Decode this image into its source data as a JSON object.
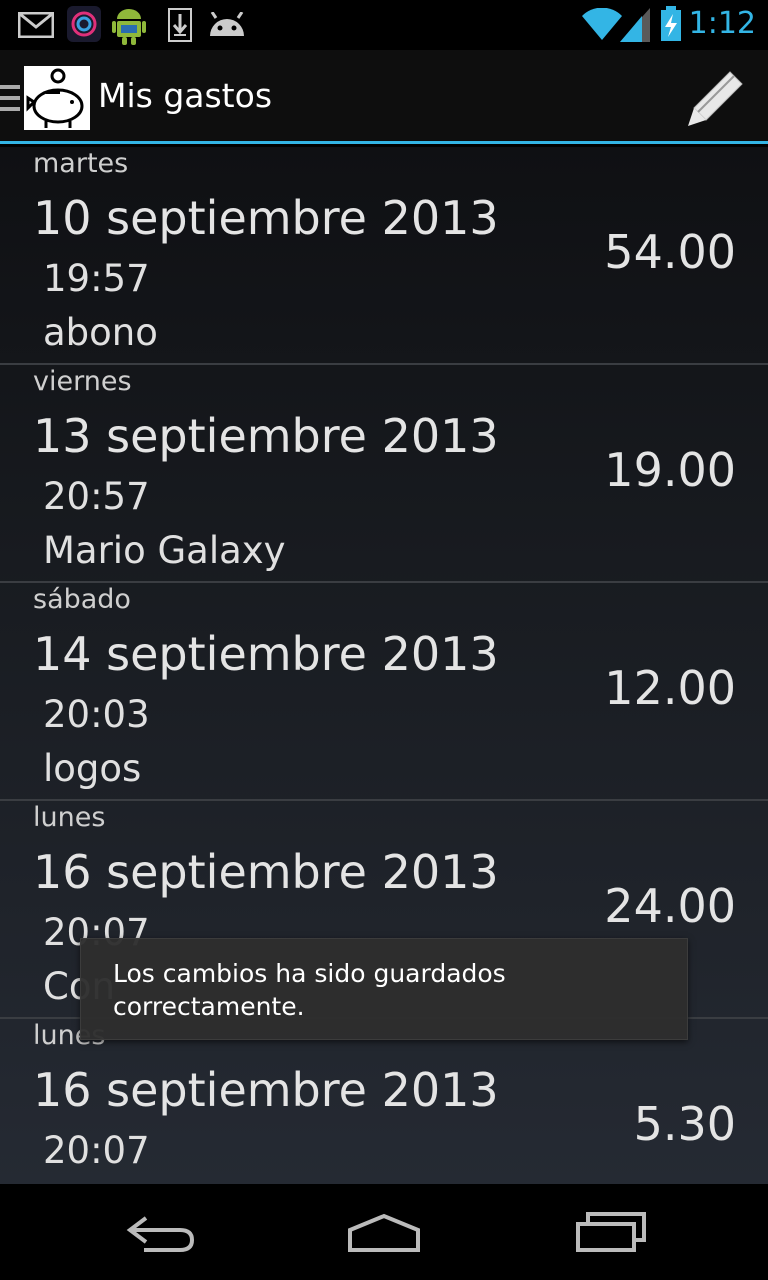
{
  "status_bar": {
    "time": "1:12",
    "icons": [
      "gmail-icon",
      "app-icon",
      "android-icon",
      "download-icon",
      "android-face-icon",
      "wifi-icon",
      "signal-icon",
      "battery-charging-icon"
    ]
  },
  "action_bar": {
    "title": "Mis gastos",
    "icons": [
      "up-icon",
      "piggy-bank-app-icon",
      "pencil-edit-icon"
    ]
  },
  "expenses": [
    {
      "day": "martes",
      "date": "10 septiembre 2013",
      "time": "19:57",
      "description": "abono",
      "amount": "54.00"
    },
    {
      "day": "viernes",
      "date": "13 septiembre 2013",
      "time": "20:57",
      "description": "Mario Galaxy",
      "amount": "19.00"
    },
    {
      "day": "sábado",
      "date": "14 septiembre 2013",
      "time": "20:03",
      "description": "logos",
      "amount": "12.00"
    },
    {
      "day": "lunes",
      "date": "16 septiembre 2013",
      "time": "20:07",
      "description": "Con",
      "amount": "24.00"
    },
    {
      "day": "lunes",
      "date": "16 septiembre 2013",
      "time": "20:07",
      "description": "",
      "amount": "5.30"
    }
  ],
  "toast": {
    "line1": "Los cambios ha sido guardados",
    "line2": "correctamente."
  },
  "nav_bar": {
    "icons": [
      "back-icon",
      "home-icon",
      "recent-apps-icon"
    ]
  },
  "colors": {
    "accent": "#33b5e5",
    "background": "#000000"
  }
}
